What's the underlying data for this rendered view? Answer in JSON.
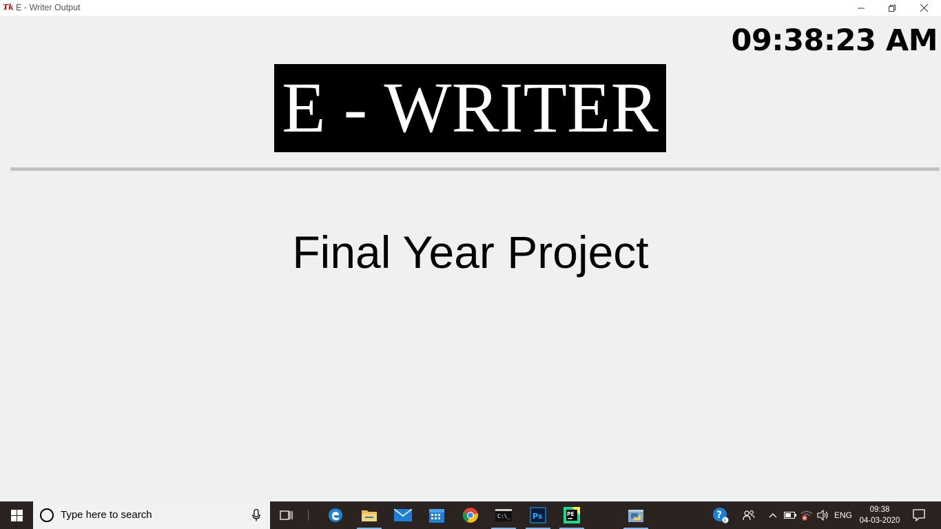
{
  "window": {
    "title": "E - Writer Output",
    "controls": [
      "minimize",
      "restore",
      "close"
    ]
  },
  "app": {
    "clock": "09:38:23 AM",
    "banner": "E - WRITER",
    "subtitle": "Final Year Project"
  },
  "taskbar": {
    "search_placeholder": "Type here to search",
    "pinned": [
      {
        "name": "task-view-icon",
        "active": false
      },
      {
        "name": "edge-icon",
        "active": false
      },
      {
        "name": "file-explorer-icon",
        "active": true
      },
      {
        "name": "mail-icon",
        "active": false
      },
      {
        "name": "calendar-icon",
        "active": false
      },
      {
        "name": "chrome-icon",
        "active": false
      },
      {
        "name": "command-prompt-icon",
        "active": true
      },
      {
        "name": "photoshop-icon",
        "active": true
      },
      {
        "name": "pycharm-icon",
        "active": true
      },
      {
        "name": "python-icon",
        "active": true
      }
    ],
    "tray": {
      "language": "ENG",
      "time": "09:38",
      "date": "04-03-2020"
    }
  },
  "colors": {
    "background": "#f0f0f0",
    "banner_bg": "#000000",
    "banner_fg": "#ffffff",
    "taskbar": "#2a231f",
    "active_indicator": "#7fb4e6"
  }
}
